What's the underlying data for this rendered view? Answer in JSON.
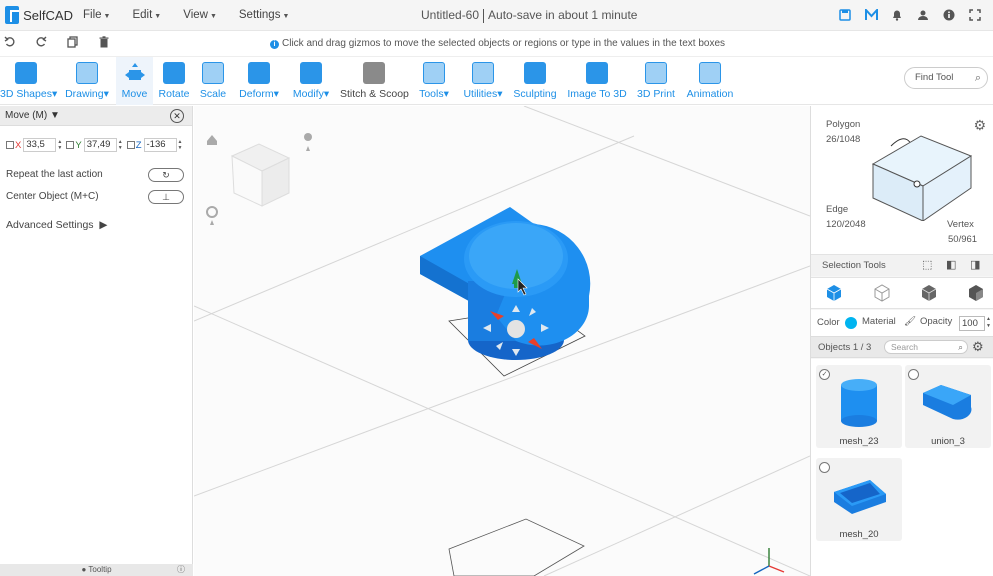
{
  "app": {
    "logo_text": "SelfCAD",
    "menu": [
      "File",
      "Edit",
      "View",
      "Settings"
    ],
    "doc_title": "Untitled-60",
    "autosave": "Auto-save in about 1 minute"
  },
  "hint": "Click and drag gizmos to move the selected objects or regions or type in the values in the text boxes",
  "toolbar": {
    "tools": [
      {
        "label": "3D Shapes",
        "caret": true
      },
      {
        "label": "Drawing",
        "caret": true
      },
      {
        "label": "Move",
        "caret": false,
        "active": true
      },
      {
        "label": "Rotate",
        "caret": false
      },
      {
        "label": "Scale",
        "caret": false
      },
      {
        "label": "Deform",
        "caret": true
      },
      {
        "label": "Modify",
        "caret": true
      },
      {
        "label": "Stitch & Scoop",
        "caret": false
      },
      {
        "label": "Tools",
        "caret": true
      },
      {
        "label": "Utilities",
        "caret": true
      },
      {
        "label": "Sculpting",
        "caret": false
      },
      {
        "label": "Image To 3D",
        "caret": false
      },
      {
        "label": "3D Print",
        "caret": false
      },
      {
        "label": "Animation",
        "caret": false
      }
    ],
    "find_tool": "Find Tool"
  },
  "left_panel": {
    "title": "Move (M)",
    "x_label": "X",
    "x_value": "33,5",
    "y_label": "Y",
    "y_value": "37,49",
    "z_label": "Z",
    "z_value": "-136",
    "repeat_label": "Repeat the last action",
    "center_label": "Center Object (M+C)",
    "advanced_label": "Advanced Settings",
    "tooltip_label": "Tooltip"
  },
  "right_panel": {
    "polygon_label": "Polygon",
    "polygon_count": "26/1048",
    "edge_label": "Edge",
    "edge_count": "120/2048",
    "vertex_label": "Vertex",
    "vertex_count": "50/961",
    "selection_tools": "Selection Tools",
    "color_label": "Color",
    "material_label": "Material",
    "opacity_label": "Opacity",
    "opacity_value": "100",
    "objects_label": "Objects 1 / 3",
    "search_placeholder": "Search",
    "objects": [
      {
        "name": "mesh_23",
        "checked": true
      },
      {
        "name": "union_3",
        "checked": false
      },
      {
        "name": "mesh_20",
        "checked": false
      }
    ]
  },
  "colors": {
    "accent": "#1d8fe6",
    "object_blue": "#1e8ff0",
    "object_color_swatch": "#00b4f0"
  }
}
